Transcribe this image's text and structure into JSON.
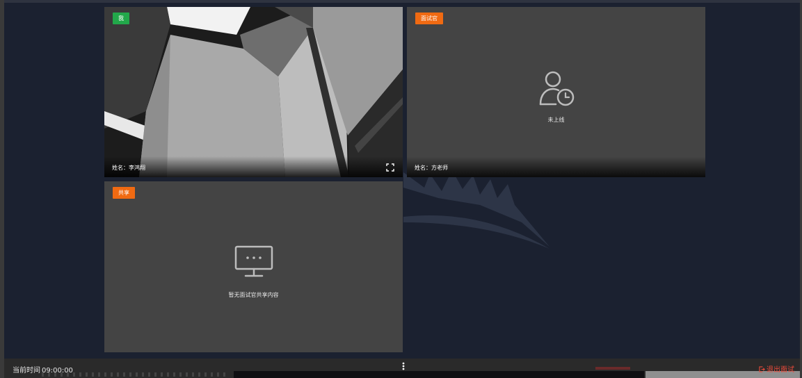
{
  "tiles": {
    "me": {
      "badge": "我",
      "name": "姓名：李鸿翔"
    },
    "interviewer": {
      "badge": "面试官",
      "name": "姓名：方老师",
      "status": "未上线"
    },
    "share": {
      "badge": "共享",
      "status": "暂无面试官共享内容"
    }
  },
  "footer": {
    "time_label": "当前时间",
    "time_value": "09:00:00",
    "exit_label": "退出面试"
  },
  "colors": {
    "badge_me": "#22a84a",
    "badge_other": "#f06a12",
    "exit": "#e84a3a",
    "background": "#1b2130",
    "tile": "#444444"
  },
  "icons": [
    "user-clock-icon",
    "monitor-icon",
    "fullscreen-icon",
    "more-vertical-icon",
    "exit-icon"
  ]
}
